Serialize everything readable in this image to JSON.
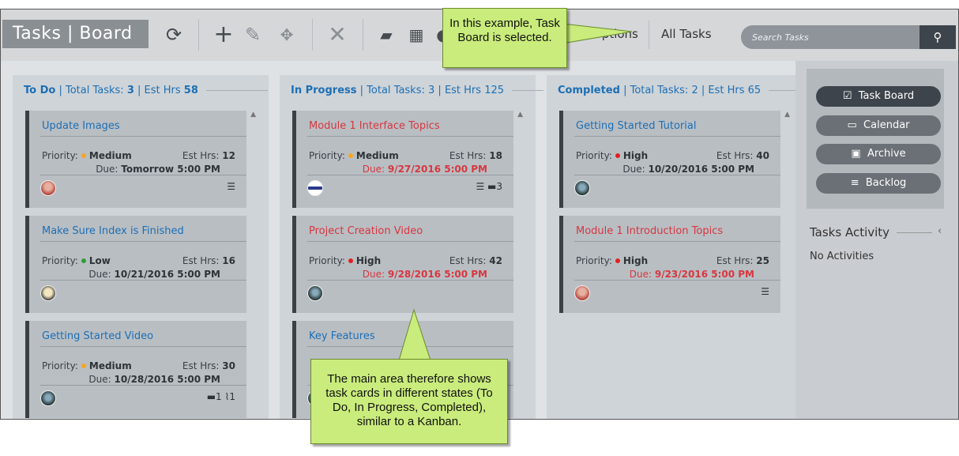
{
  "header": {
    "title_left": "Tasks",
    "title_sep": "|",
    "title_right": "Board",
    "options_label": "Options",
    "all_tasks_label": "All Tasks",
    "search_placeholder": "Search Tasks"
  },
  "columns": [
    {
      "name": "To Do",
      "total_label": "Total Tasks:",
      "total": "3",
      "hrs_label": "Est Hrs",
      "hrs": "58",
      "cards": [
        {
          "title": "Update Images",
          "title_red": false,
          "priority_label": "Priority:",
          "priority": "Medium",
          "priority_color": "#f5a623",
          "est_label": "Est Hrs:",
          "est": "12",
          "due_label": "Due:",
          "due": "Tomorrow 5:00 PM",
          "due_red": false,
          "icons": "☰"
        },
        {
          "title": "Make Sure Index is Finished",
          "title_red": false,
          "priority_label": "Priority:",
          "priority": "Low",
          "priority_color": "#2e9e3a",
          "est_label": "Est Hrs:",
          "est": "16",
          "due_label": "Due:",
          "due": "10/21/2016 5:00 PM",
          "due_red": false,
          "icons": ""
        },
        {
          "title": "Getting Started Video",
          "title_red": false,
          "priority_label": "Priority:",
          "priority": "Medium",
          "priority_color": "#f5a623",
          "est_label": "Est Hrs:",
          "est": "30",
          "due_label": "Due:",
          "due": "10/28/2016 5:00 PM",
          "due_red": false,
          "icons": "▬1  ⌇1"
        }
      ]
    },
    {
      "name": "In Progress",
      "total_label": "Total Tasks:",
      "total": "3",
      "hrs_label": "Est Hrs",
      "hrs": "125",
      "cards": [
        {
          "title": "Module 1 Interface Topics",
          "title_red": true,
          "priority_label": "Priority:",
          "priority": "Medium",
          "priority_color": "#f5a623",
          "est_label": "Est Hrs:",
          "est": "18",
          "due_label": "Due:",
          "due": "9/27/2016 5:00 PM",
          "due_red": true,
          "icons": "☰  ▬3"
        },
        {
          "title": "Project Creation Video",
          "title_red": true,
          "priority_label": "Priority:",
          "priority": "High",
          "priority_color": "#e02020",
          "est_label": "Est Hrs:",
          "est": "42",
          "due_label": "Due:",
          "due": "9/28/2016 5:00 PM",
          "due_red": true,
          "icons": ""
        },
        {
          "title": "Key Features",
          "title_red": false,
          "priority_label": "",
          "priority": "",
          "priority_color": "#f5a623",
          "est_label": "",
          "est": "",
          "due_label": "",
          "due": "",
          "due_red": false,
          "icons": ""
        }
      ]
    },
    {
      "name": "Completed",
      "total_label": "Total Tasks:",
      "total": "2",
      "hrs_label": "Est Hrs",
      "hrs": "65",
      "cards": [
        {
          "title": "Getting Started Tutorial",
          "title_red": false,
          "priority_label": "Priority:",
          "priority": "High",
          "priority_color": "#e02020",
          "est_label": "Est Hrs:",
          "est": "40",
          "due_label": "Due:",
          "due": "10/20/2016 5:00 PM",
          "due_red": false,
          "icons": ""
        },
        {
          "title": "Module 1 Introduction Topics",
          "title_red": true,
          "priority_label": "Priority:",
          "priority": "High",
          "priority_color": "#e02020",
          "est_label": "Est Hrs:",
          "est": "25",
          "due_label": "Due:",
          "due": "9/23/2016 5:00 PM",
          "due_red": true,
          "icons": "☰"
        }
      ]
    }
  ],
  "sidebar": {
    "buttons": [
      {
        "label": "Task Board",
        "icon": "checkbox-icon",
        "glyph": "☑",
        "active": true
      },
      {
        "label": "Calendar",
        "icon": "calendar-icon",
        "glyph": "▭",
        "active": false
      },
      {
        "label": "Archive",
        "icon": "archive-icon",
        "glyph": "▣",
        "active": false
      },
      {
        "label": "Backlog",
        "icon": "backlog-icon",
        "glyph": "≡",
        "active": false
      }
    ],
    "activity_title": "Tasks Activity",
    "activity_empty": "No Activities"
  },
  "callouts": {
    "top": "In this example, Task Board is selected.",
    "bottom": "The main area therefore shows task cards in different states (To Do, In Progress, Completed), similar to a Kanban."
  },
  "colors": {
    "link_blue": "#1c6fb5",
    "overdue_red": "#d7373f",
    "callout_green": "#c9ec7c"
  }
}
